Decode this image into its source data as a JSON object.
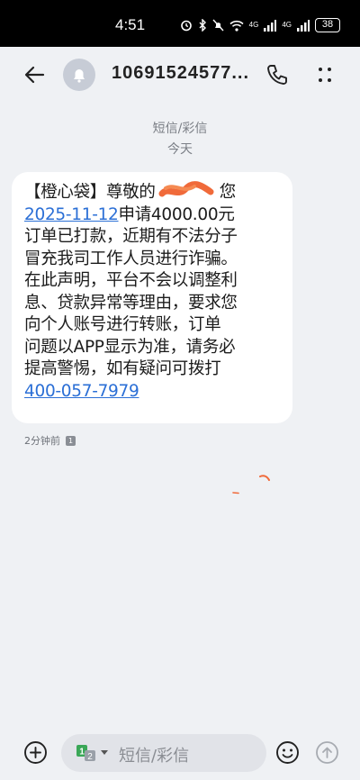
{
  "status_bar": {
    "time": "4:51",
    "network_1": "4G",
    "network_2": "4G",
    "battery": "38",
    "icons": [
      "alarm-icon",
      "bluetooth-icon",
      "mute-icon",
      "wifi-icon",
      "signal-icon",
      "battery-icon"
    ]
  },
  "header": {
    "contact": "10691524577...",
    "icons": [
      "back-arrow-icon",
      "bell-avatar-icon",
      "phone-icon",
      "more-icon"
    ]
  },
  "conversation": {
    "channel": "短信/彩信",
    "day": "今天"
  },
  "message": {
    "line1": "【橙心袋】尊敬的",
    "line1_tail": "您",
    "date_link": "2025-11-12",
    "line2_rest": "申请4000.00元",
    "line3": "订单已打款，近期有不法分子",
    "line4": "冒充我司工作人员进行诈骗。",
    "line5": "在此声明，平台不会以调整利",
    "line6": "息、贷款异常等理由，要求您",
    "line7": "向个人账号进行转账，订单",
    "line8": "问题以APP显示为准，请务必",
    "line9": "提高警惕，如有疑问可拨打",
    "phone_link": "400-057-7979",
    "time": "2分钟前",
    "sim": "1"
  },
  "composer": {
    "placeholder": "短信/彩信",
    "sim_selected": "1",
    "sim_alt": "2",
    "icons": [
      "add-icon",
      "sim-select-icon",
      "emoji-icon",
      "send-icon"
    ]
  },
  "colors": {
    "background": "#eff1f4",
    "bubble": "#ffffff",
    "link": "#2b6fd6",
    "sim_green": "#3aa757"
  }
}
